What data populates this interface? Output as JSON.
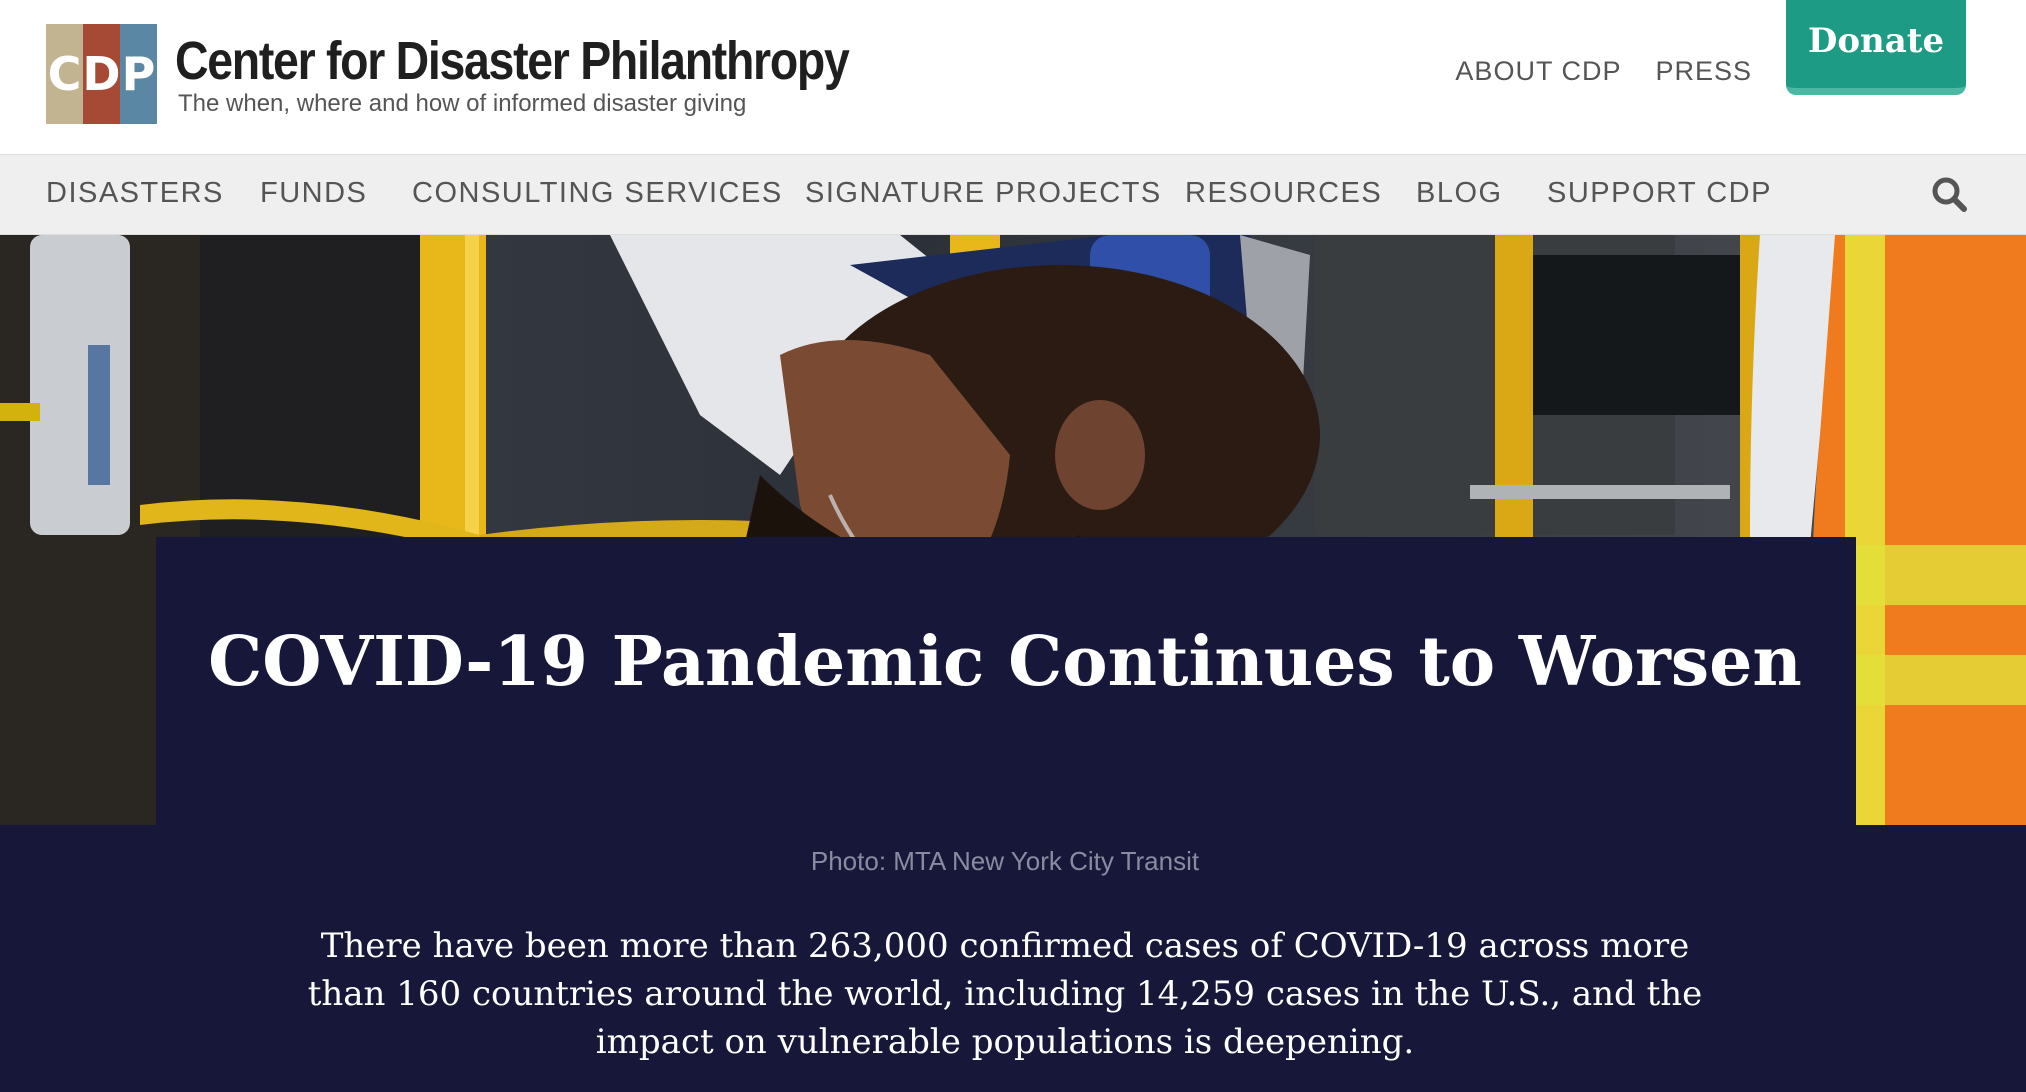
{
  "logo": {
    "letters": [
      "C",
      "D",
      "P"
    ],
    "tile_colors": [
      "#c2b490",
      "#a64a35",
      "#5a87a3"
    ],
    "title": "Center for Disaster Philanthropy",
    "tagline": "The when, where and how of informed disaster giving"
  },
  "utility_nav": {
    "about": "ABOUT CDP",
    "press": "PRESS",
    "donate": "Donate"
  },
  "main_nav": {
    "items": [
      "DISASTERS",
      "FUNDS",
      "CONSULTING SERVICES",
      "SIGNATURE PROJECTS",
      "RESOURCES",
      "BLOG",
      "SUPPORT CDP"
    ],
    "search_icon": "search-icon"
  },
  "article": {
    "headline": "COVID-19 Pandemic Continues to Worsen",
    "photo_credit": "Photo: MTA New York City Transit",
    "intro": "There have been more than 263,000 confirmed cases of COVID-19 across more than 160 countries around the world, including 14,259 cases in the U.S., and the impact on vulnerable populations is deepening."
  },
  "colors": {
    "navy": "#171839",
    "accent_green": "#1e9b84",
    "nav_background": "#efefef"
  }
}
